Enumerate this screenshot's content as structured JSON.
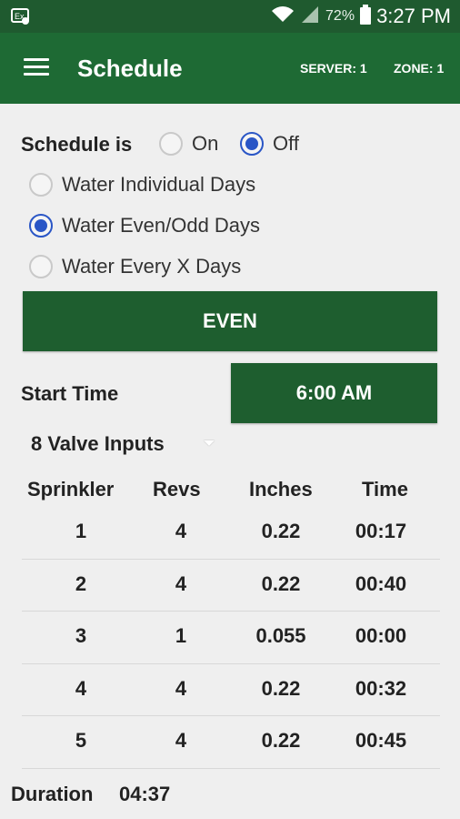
{
  "status_bar": {
    "battery_pct": "72%",
    "time": "3:27 PM",
    "icons": [
      "notification-icon",
      "wifi-icon",
      "signal-icon",
      "battery-icon"
    ]
  },
  "app_bar": {
    "title": "Schedule",
    "server": "SERVER: 1",
    "zone": "ZONE: 1"
  },
  "schedule": {
    "label": "Schedule is",
    "on_label": "On",
    "off_label": "Off",
    "selected": "Off"
  },
  "modes": [
    {
      "label": "Water Individual Days",
      "checked": false
    },
    {
      "label": "Water Even/Odd Days",
      "checked": true
    },
    {
      "label": "Water Every X Days",
      "checked": false
    }
  ],
  "even_button": "EVEN",
  "start_time": {
    "label": "Start Time",
    "value": "6:00 AM"
  },
  "valve_select": {
    "value": "8 Valve Inputs"
  },
  "table": {
    "headers": [
      "Sprinkler",
      "Revs",
      "Inches",
      "Time"
    ],
    "rows": [
      {
        "sprinkler": "1",
        "revs": "4",
        "inches": "0.22",
        "time": "00:17"
      },
      {
        "sprinkler": "2",
        "revs": "4",
        "inches": "0.22",
        "time": "00:40"
      },
      {
        "sprinkler": "3",
        "revs": "1",
        "inches": "0.055",
        "time": "00:00"
      },
      {
        "sprinkler": "4",
        "revs": "4",
        "inches": "0.22",
        "time": "00:32"
      },
      {
        "sprinkler": "5",
        "revs": "4",
        "inches": "0.22",
        "time": "00:45"
      }
    ]
  },
  "duration": {
    "label": "Duration",
    "value": "04:37"
  },
  "colors": {
    "status_bar": "#1f5a2f",
    "app_bar": "#1e6a34",
    "button": "#1e5e2f",
    "radio_accent": "#2a56c6"
  }
}
